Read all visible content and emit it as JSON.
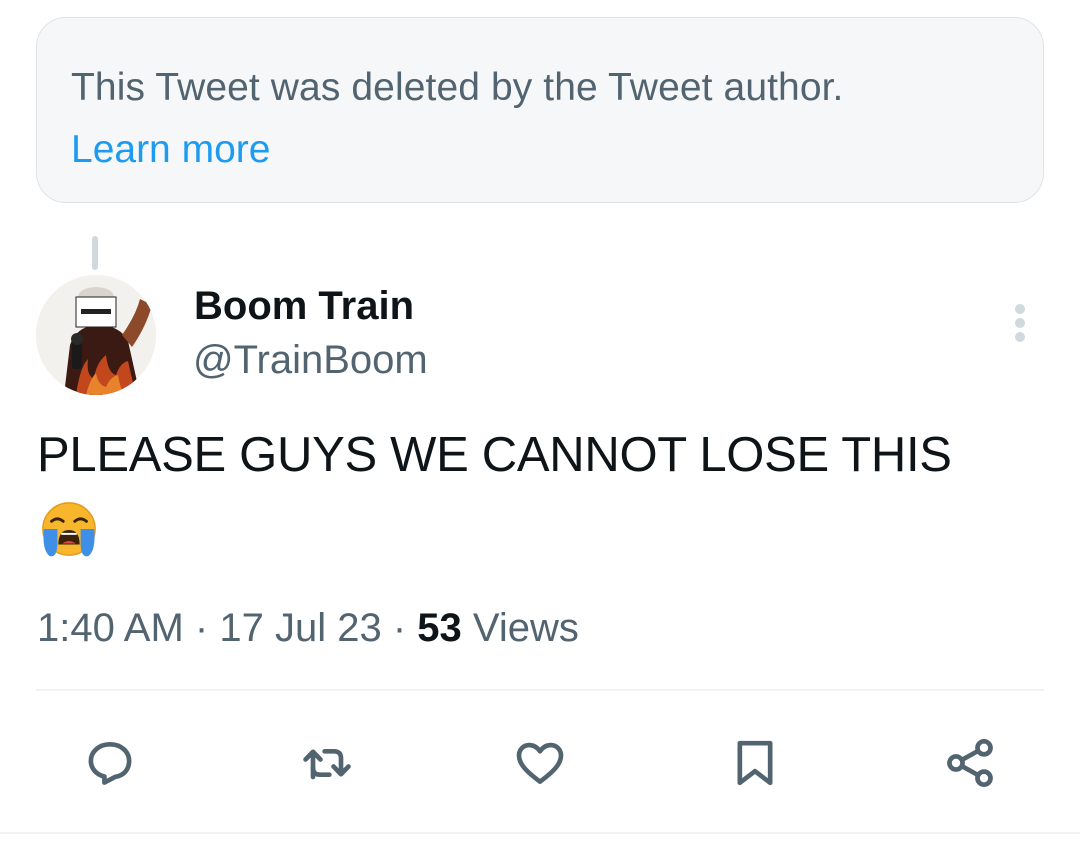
{
  "deleted_notice": {
    "text": "This Tweet was deleted by the Tweet author.",
    "link": "Learn more"
  },
  "tweet": {
    "display_name": "Boom Train",
    "handle": "@TrainBoom",
    "text": "PLEASE GUYS WE CANNOT LOSE THIS",
    "emoji": "loudly-crying-face",
    "time": "1:40 AM",
    "date": "17 Jul 23",
    "separator": "·",
    "views_count": "53",
    "views_label": "Views"
  },
  "actions": [
    {
      "name": "reply",
      "icon": "reply-icon"
    },
    {
      "name": "retweet",
      "icon": "retweet-icon"
    },
    {
      "name": "like",
      "icon": "heart-icon"
    },
    {
      "name": "bookmark",
      "icon": "bookmark-icon"
    },
    {
      "name": "share",
      "icon": "share-icon"
    }
  ],
  "colors": {
    "text": "#0f1419",
    "secondary": "#536471",
    "link": "#1d9bf0",
    "notice_bg": "#f6f7f8",
    "border": "#eff3f4"
  }
}
